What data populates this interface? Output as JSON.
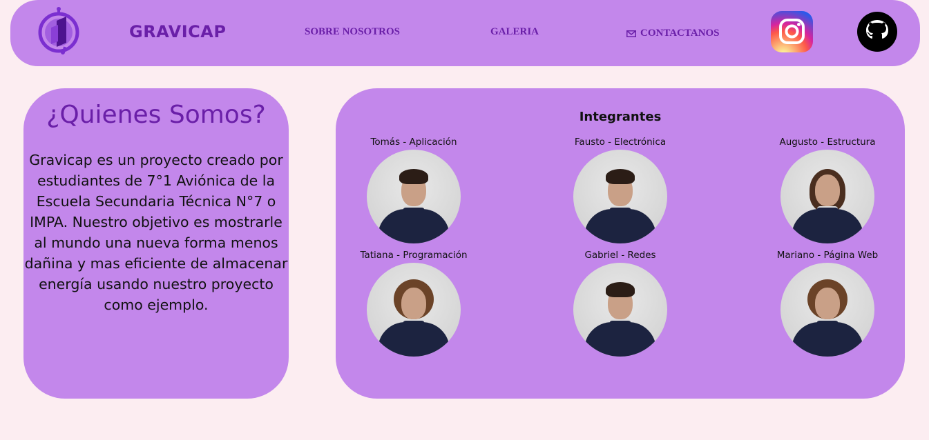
{
  "header": {
    "brand": "GRAVICAP",
    "nav": [
      {
        "label": "SOBRE NOSOTROS"
      },
      {
        "label": "GALERIA"
      },
      {
        "label": "CONTACTANOS",
        "icon": "mail-icon"
      }
    ],
    "social": [
      {
        "name": "instagram-icon"
      },
      {
        "name": "github-icon"
      }
    ]
  },
  "about": {
    "title": "¿Quienes Somos?",
    "text": "Gravicap es un proyecto creado por estudiantes de 7°1 Aviónica de la Escuela Secundaria Técnica N°7 o IMPA. Nuestro objetivo es mostrarle al mundo una nueva forma menos dañina y mas eficiente de almacenar energía usando nuestro proyecto como ejemplo."
  },
  "team": {
    "title": "Integrantes",
    "members": [
      {
        "name": "Tomás - Aplicación"
      },
      {
        "name": "Fausto - Electrónica"
      },
      {
        "name": "Augusto - Estructura"
      },
      {
        "name": "Tatiana - Programación"
      },
      {
        "name": "Gabriel - Redes"
      },
      {
        "name": "Mariano - Página Web"
      }
    ]
  },
  "colors": {
    "background": "#fcedf1",
    "card": "#c387eb",
    "accent": "#6a1fa8"
  }
}
